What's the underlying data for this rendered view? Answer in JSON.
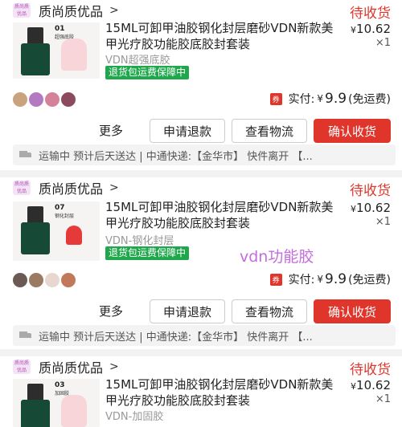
{
  "orders": [
    {
      "shop_logo": "质尚质优品",
      "shop_name": "质尚质优品",
      "chevron": ">",
      "status": "待收货",
      "thumb_num": "01",
      "thumb_text": "超强底胶",
      "product_name": "15ML可卸甲油胶钢化封层磨砂VDN新款美甲光疗胶功能胶底胶封套装",
      "price_symbol": "¥",
      "price": "10.62",
      "qty": "×1",
      "spec": "VDN超强底胶",
      "badge": "退货包运费保障中",
      "coupon": "券",
      "paid_label": "实付:",
      "paid_symbol": "¥",
      "paid_amount": "9.9",
      "paid_note": "(免运费)",
      "more": "更多",
      "btn_refund": "申请退款",
      "btn_logistics": "查看物流",
      "btn_confirm": "确认收货",
      "track_text": "运输中 预计后天送达 | 中通快递:【金华市】 快件离开 【..."
    },
    {
      "shop_logo": "质尚质优品",
      "shop_name": "质尚质优品",
      "chevron": ">",
      "status": "待收货",
      "thumb_num": "07",
      "thumb_text": "钢化封层",
      "product_name": "15ML可卸甲油胶钢化封层磨砂VDN新款美甲光疗胶功能胶底胶封套装",
      "price_symbol": "¥",
      "price": "10.62",
      "qty": "×1",
      "spec": "VDN-钢化封层",
      "badge": "退货包运费保障中",
      "coupon": "券",
      "paid_label": "实付:",
      "paid_symbol": "¥",
      "paid_amount": "9.9",
      "paid_note": "(免运费)",
      "more": "更多",
      "btn_refund": "申请退款",
      "btn_logistics": "查看物流",
      "btn_confirm": "确认收货",
      "track_text": "运输中 预计后天送达 | 中通快递:【金华市】 快件离开 【..."
    },
    {
      "shop_logo": "质尚质优品",
      "shop_name": "质尚质优品",
      "chevron": ">",
      "status": "待收货",
      "thumb_num": "03",
      "thumb_text": "加固胶",
      "product_name": "15ML可卸甲油胶钢化封层磨砂VDN新款美甲光疗胶功能胶底胶封套装",
      "price_symbol": "¥",
      "price": "10.62",
      "qty": "×1",
      "spec": "VDN-加固胶"
    }
  ],
  "watermark": "vdn功能胶",
  "colors": {
    "accent_red": "#e0352b",
    "badge_green": "#1fa84b",
    "watermark_purple": "#c56be0"
  }
}
